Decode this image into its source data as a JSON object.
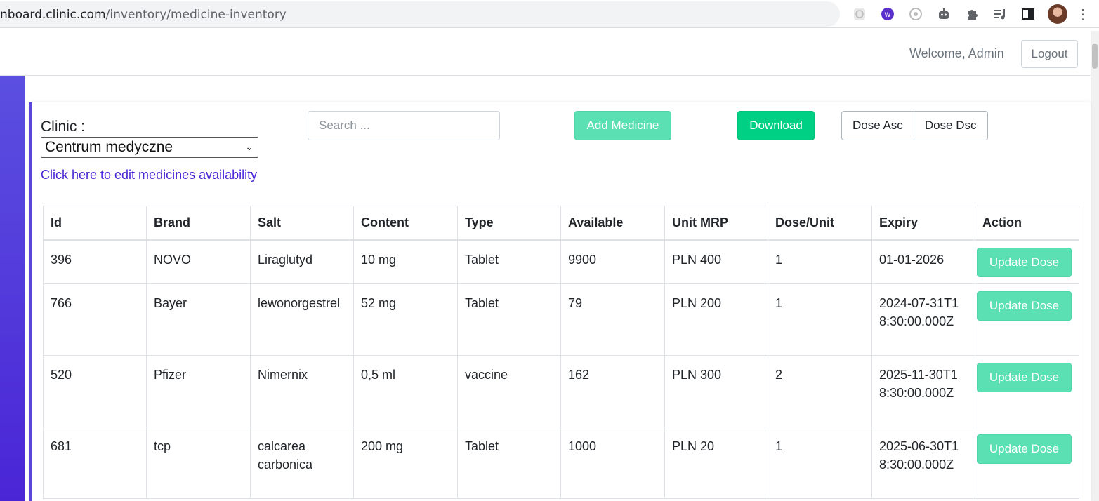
{
  "browser": {
    "url_host": "nboard.clinic.com",
    "url_path": "/inventory/medicine-inventory"
  },
  "header": {
    "welcome": "Welcome, Admin",
    "logout_label": "Logout"
  },
  "filters": {
    "clinic_label": "Clinic :",
    "clinic_selected": "Centrum medyczne",
    "edit_link": "Click here to edit medicines availability",
    "search_placeholder": "Search ..."
  },
  "toolbar": {
    "add_label": "Add Medicine",
    "download_label": "Download",
    "dose_asc_label": "Dose Asc",
    "dose_dsc_label": "Dose Dsc"
  },
  "table": {
    "columns": [
      "Id",
      "Brand",
      "Salt",
      "Content",
      "Type",
      "Available",
      "Unit MRP",
      "Dose/Unit",
      "Expiry",
      "Action"
    ],
    "action_label": "Update Dose",
    "rows": [
      {
        "id": "396",
        "brand": "NOVO",
        "salt": "Liraglutyd",
        "content": "10 mg",
        "type": "Tablet",
        "available": "9900",
        "mrp": "PLN 400",
        "dose": "1",
        "expiry": "01-01-2026"
      },
      {
        "id": "766",
        "brand": "Bayer",
        "salt": "lewonorgestrel",
        "content": "52 mg",
        "type": "Tablet",
        "available": "79",
        "mrp": "PLN 200",
        "dose": "1",
        "expiry": "2024-07-31T18:30:00.000Z"
      },
      {
        "id": "520",
        "brand": "Pfizer",
        "salt": "Nimernix",
        "content": "0,5 ml",
        "type": "vaccine",
        "available": "162",
        "mrp": "PLN 300",
        "dose": "2",
        "expiry": "2025-11-30T18:30:00.000Z"
      },
      {
        "id": "681",
        "brand": "tcp",
        "salt": "calcarea carbonica",
        "content": "200 mg",
        "type": "Tablet",
        "available": "1000",
        "mrp": "PLN 20",
        "dose": "1",
        "expiry": "2025-06-30T18:30:00.000Z"
      }
    ]
  },
  "icons": [
    "extension-1-icon",
    "extension-2-icon",
    "extension-3-icon",
    "robot-icon",
    "puzzle-icon",
    "media-icon",
    "sidepanel-icon",
    "profile-avatar",
    "more-icon"
  ],
  "colors": {
    "accent": "#4a25d6",
    "success": "#00d084",
    "success_light": "#5be0b3"
  }
}
